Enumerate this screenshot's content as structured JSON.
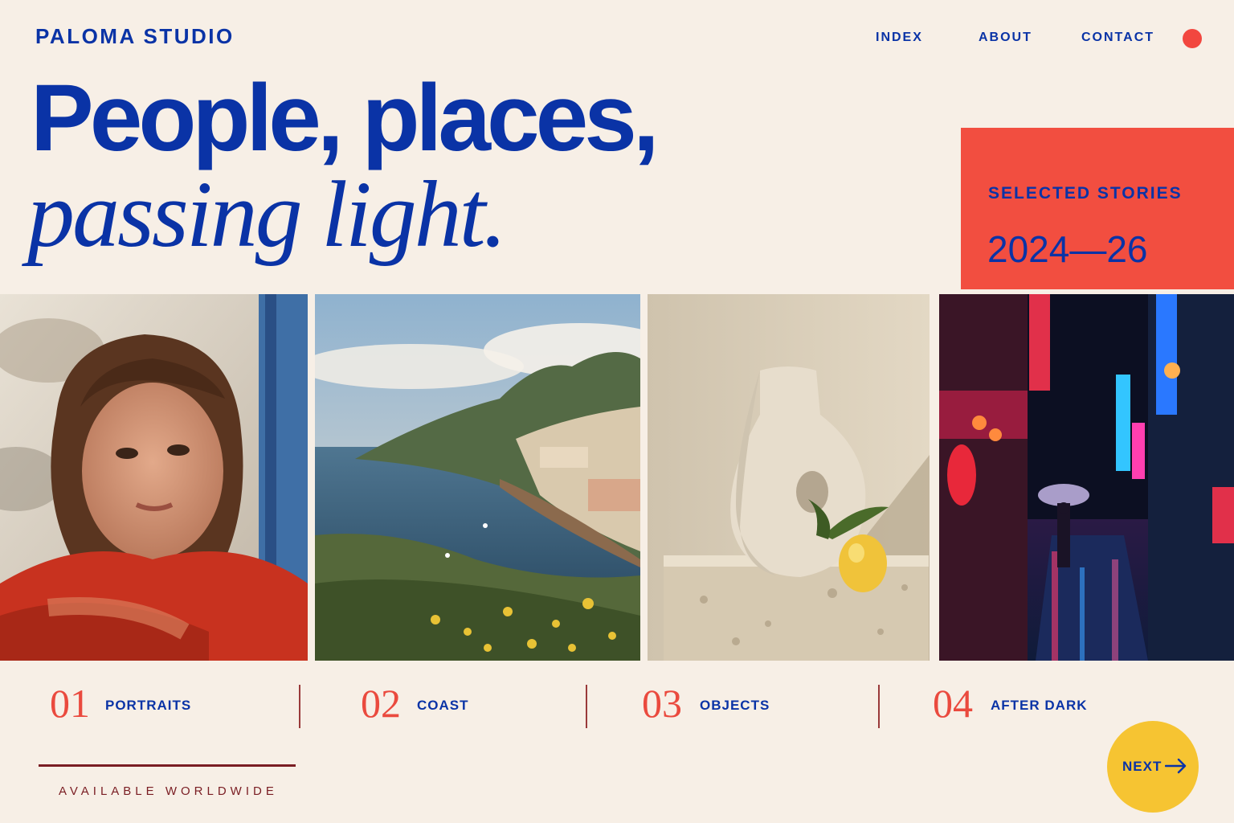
{
  "header": {
    "brand": "PALOMA STUDIO",
    "nav": [
      "INDEX",
      "ABOUT",
      "CONTACT"
    ]
  },
  "hero": {
    "line1": "People, places,",
    "line2": "passing light."
  },
  "feature": {
    "label": "SELECTED STORIES",
    "years": "2024—26"
  },
  "stories": [
    {
      "num": "01",
      "label": "PORTRAITS",
      "image": "portrait-photo"
    },
    {
      "num": "02",
      "label": "COAST",
      "image": "coast-photo"
    },
    {
      "num": "03",
      "label": "OBJECTS",
      "image": "objects-photo"
    },
    {
      "num": "04",
      "label": "AFTER DARK",
      "image": "after-dark-photo"
    }
  ],
  "footer": {
    "tagline": "AVAILABLE WORLDWIDE",
    "next_label": "NEXT",
    "next_icon": "arrow-right-icon"
  },
  "colors": {
    "background": "#f7efe6",
    "primary_blue": "#0a33a6",
    "accent_red": "#f24e40",
    "accent_yellow": "#f6c432",
    "footer_maroon": "#7a1d23"
  }
}
